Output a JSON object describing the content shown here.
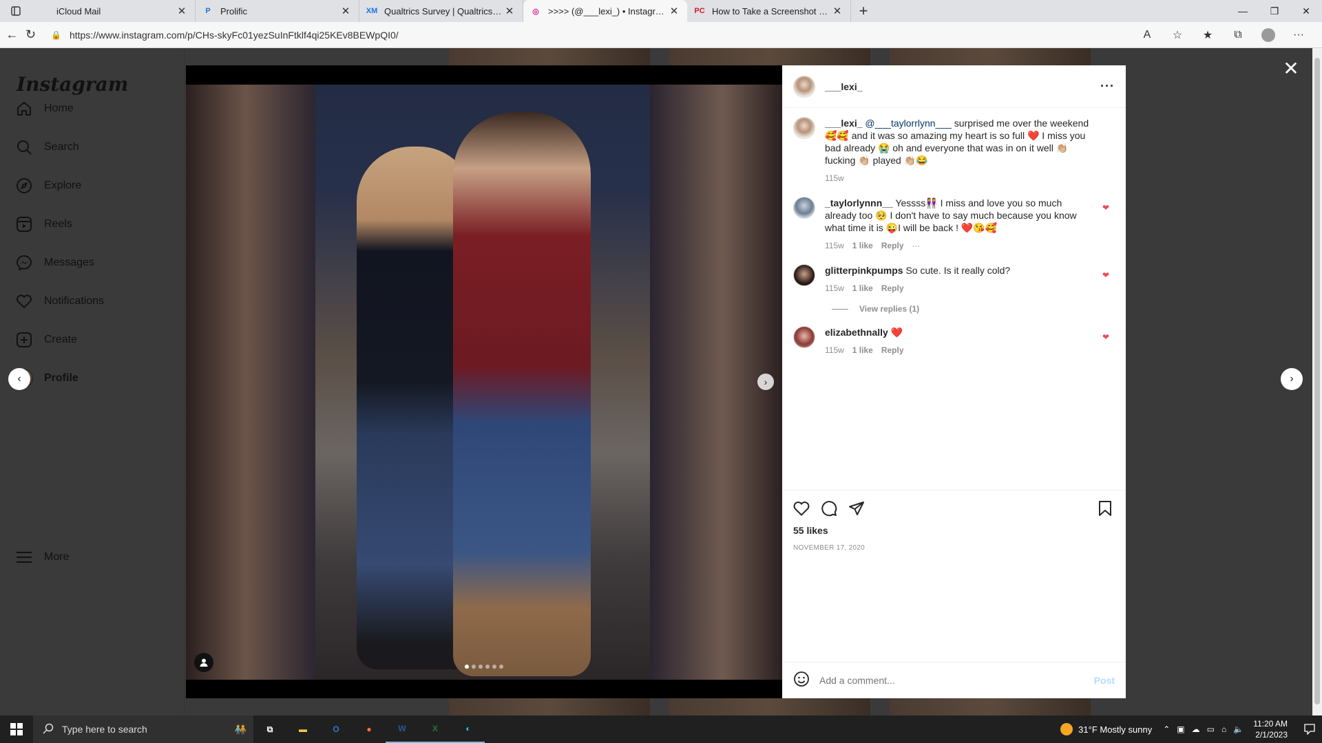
{
  "browser": {
    "tabs": [
      {
        "title": "iCloud Mail",
        "fav": "",
        "favColor": "#8e8e8e",
        "active": false
      },
      {
        "title": "Prolific",
        "fav": "P",
        "favColor": "#1a73e8",
        "active": false
      },
      {
        "title": "Qualtrics Survey | Qualtrics Exper",
        "fav": "XM",
        "favColor": "#1a73e8",
        "active": false
      },
      {
        "title": ">>>> (@___lexi_) • Instagram p",
        "fav": "◎",
        "favColor": "#d6249f",
        "active": true
      },
      {
        "title": "How to Take a Screenshot on An",
        "fav": "PC",
        "favColor": "#d21e1e",
        "active": false
      }
    ],
    "url": "https://www.instagram.com/p/CHs-skyFc01yezSuInFtklf4qi25KEv8BEWpQI0/"
  },
  "instagram": {
    "logo": "Instagram",
    "nav": [
      {
        "label": "Home",
        "icon": "home-icon"
      },
      {
        "label": "Search",
        "icon": "search-icon"
      },
      {
        "label": "Explore",
        "icon": "compass-icon"
      },
      {
        "label": "Reels",
        "icon": "reels-icon"
      },
      {
        "label": "Messages",
        "icon": "messenger-icon"
      },
      {
        "label": "Notifications",
        "icon": "heart-icon"
      },
      {
        "label": "Create",
        "icon": "plus-square-icon"
      },
      {
        "label": "Profile",
        "icon": "avatar"
      }
    ],
    "more": "More"
  },
  "post": {
    "author": "___lexi_",
    "photo_count": 6,
    "photo_index": 1,
    "caption": {
      "user": "___lexi_",
      "mention": "@___taylorrlynn___",
      "text": " surprised me over the weekend 🥰🥰 and it was so amazing my heart is so full ❤️ I miss you bad already 😭 oh and everyone that was in on it well 👏🏼 fucking 👏🏼 played 👏🏼😂",
      "age": "115w"
    },
    "comments": [
      {
        "user": "_taylorlynnn__",
        "text": " Yessss👭 I miss and love you so much already too 🥺 I don't have to say much because you know what time it is 😜I will be back ! ❤️😘🥰",
        "age": "115w",
        "likes": "1 like",
        "reply": "Reply",
        "more": "···",
        "avatar": "taylor"
      },
      {
        "user": "glitterpinkpumps",
        "text": " So cute. Is it really cold?",
        "age": "115w",
        "likes": "1 like",
        "reply": "Reply",
        "more": "",
        "avatar": "glitter"
      },
      {
        "user": "elizabethnally",
        "text": " ❤️",
        "age": "115w",
        "likes": "1 like",
        "reply": "Reply",
        "more": "",
        "avatar": "eliz"
      }
    ],
    "view_replies": "View replies (1)",
    "likes": "55 likes",
    "date": "NOVEMBER 17, 2020",
    "comment_placeholder": "Add a comment...",
    "post_label": "Post"
  },
  "taskbar": {
    "search_placeholder": "Type here to search",
    "weather": "31°F  Mostly sunny",
    "time": "11:20 AM",
    "date": "2/1/2023"
  }
}
